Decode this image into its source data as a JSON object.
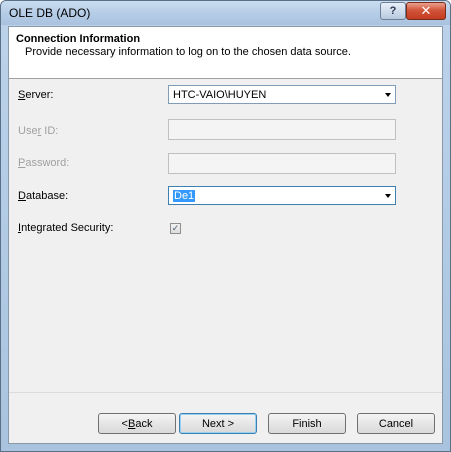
{
  "window": {
    "title": "OLE DB (ADO)",
    "help_glyph": "?",
    "close_glyph": "✕"
  },
  "header": {
    "title": "Connection Information",
    "subtitle": "Provide necessary information to log on to the chosen data source."
  },
  "form": {
    "server": {
      "label_pre": "",
      "label_key": "S",
      "label_post": "erver:",
      "value": "HTC-VAIO\\HUYEN"
    },
    "user_id": {
      "label_pre": "Use",
      "label_key": "r",
      "label_post": " ID:",
      "value": ""
    },
    "password": {
      "label_pre": "",
      "label_key": "P",
      "label_post": "assword:",
      "value": ""
    },
    "database": {
      "label_pre": "",
      "label_key": "D",
      "label_post": "atabase:",
      "value": "De1"
    },
    "integrated_security": {
      "label_pre": "",
      "label_key": "I",
      "label_post": "ntegrated Security:",
      "checked": true,
      "check_glyph": "✓"
    }
  },
  "buttons": {
    "back": {
      "pre": "< ",
      "key": "B",
      "post": "ack"
    },
    "next": "Next >",
    "finish": "Finish",
    "cancel": "Cancel"
  }
}
